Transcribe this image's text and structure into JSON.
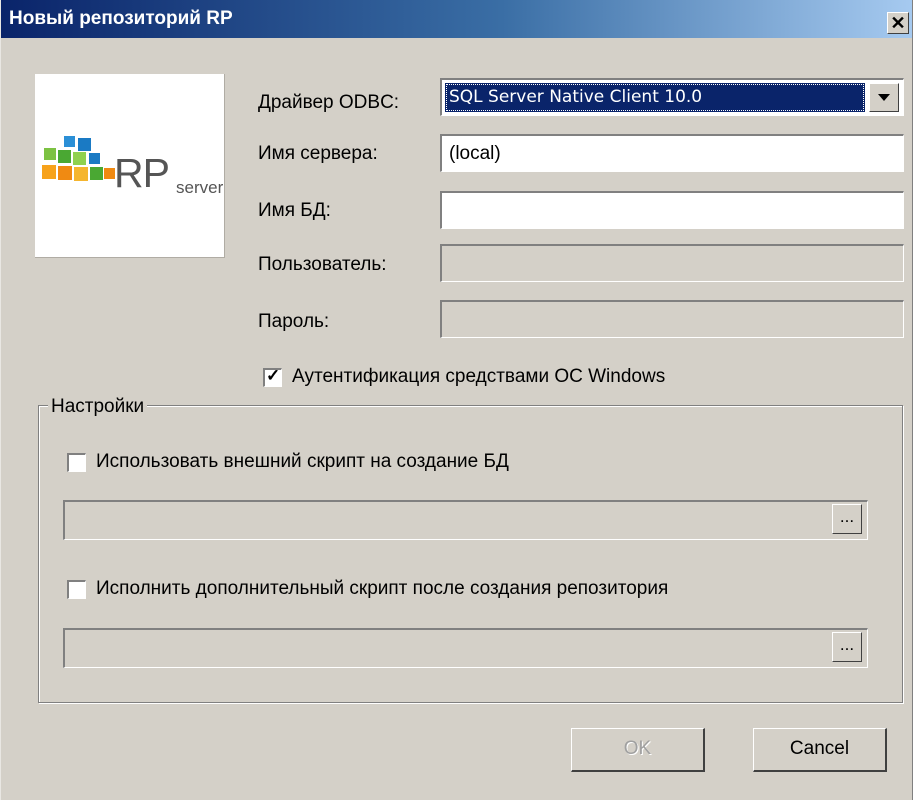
{
  "window": {
    "title": "Новый репозиторий RP",
    "close_glyph": "✕"
  },
  "logo": {
    "main": "RP",
    "sub": "server"
  },
  "form": {
    "driver_label": "Драйвер ODBC:",
    "driver_value": "SQL Server Native Client 10.0",
    "server_label": "Имя сервера:",
    "server_value": "(local)",
    "db_label": "Имя БД:",
    "db_value": "",
    "user_label": "Пользователь:",
    "user_value": "",
    "password_label": "Пароль:",
    "password_value": "",
    "windows_auth_label": "Аутентификация средствами ОС Windows",
    "windows_auth_checked": true
  },
  "settings": {
    "title": "Настройки",
    "external_script_label": "Использовать внешний скрипт на создание БД",
    "external_script_checked": false,
    "external_script_path": "",
    "extra_script_label": "Исполнить дополнительный скрипт после создания репозитория",
    "extra_script_checked": false,
    "extra_script_path": "",
    "browse_label": "..."
  },
  "buttons": {
    "ok": "OK",
    "cancel": "Cancel"
  },
  "icons": {
    "close": "close-icon",
    "dropdown": "chevron-down-icon",
    "check": "checkmark-icon",
    "logo": "rp-server-logo"
  },
  "colors": {
    "titlebar_start": "#0a246a",
    "titlebar_end": "#a6caf0",
    "dialog_bg": "#d4d0c8",
    "selection": "#0a246a"
  }
}
